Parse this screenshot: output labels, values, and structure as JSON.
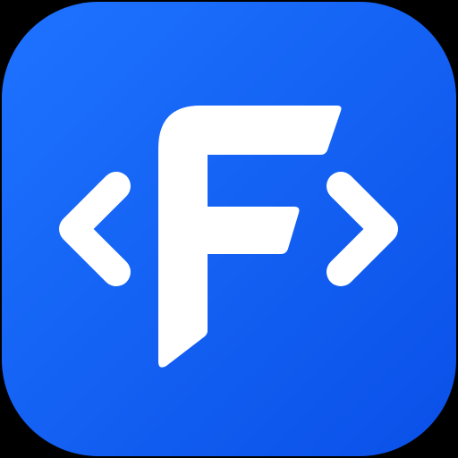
{
  "icon": {
    "logo_text": "F",
    "symbol_left": "<",
    "symbol_right": ">",
    "colors": {
      "background_top_left": "#1e73ff",
      "background_bottom_right": "#0a50e8",
      "glyph": "#ffffff",
      "canvas": "#000000"
    }
  }
}
